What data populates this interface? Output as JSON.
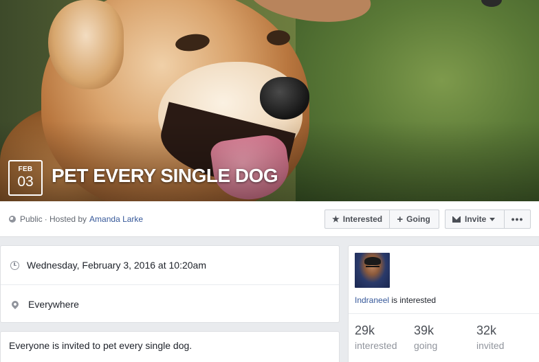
{
  "event": {
    "date_month": "FEB",
    "date_day": "03",
    "title": "PET EVERY SINGLE DOG",
    "privacy": "Public",
    "hosted_by_prefix": "· Hosted by",
    "host": "Amanda Larke"
  },
  "actions": {
    "interested_label": "Interested",
    "going_label": "Going",
    "invite_label": "Invite",
    "more_label": "•••",
    "interested_icon": "star-icon",
    "going_icon": "plus-icon",
    "invite_icon": "mail-icon"
  },
  "details": {
    "datetime": "Wednesday, February 3, 2016 at 10:20am",
    "location": "Everywhere",
    "description": "Everyone is invited to pet every single dog."
  },
  "sidebar": {
    "friend_name": "Indraneel",
    "friend_status": "is interested",
    "stats": [
      {
        "value": "29k",
        "label": "interested"
      },
      {
        "value": "39k",
        "label": "going"
      },
      {
        "value": "32k",
        "label": "invited"
      }
    ]
  },
  "colors": {
    "link": "#365899",
    "page_background": "#e9ebee"
  }
}
